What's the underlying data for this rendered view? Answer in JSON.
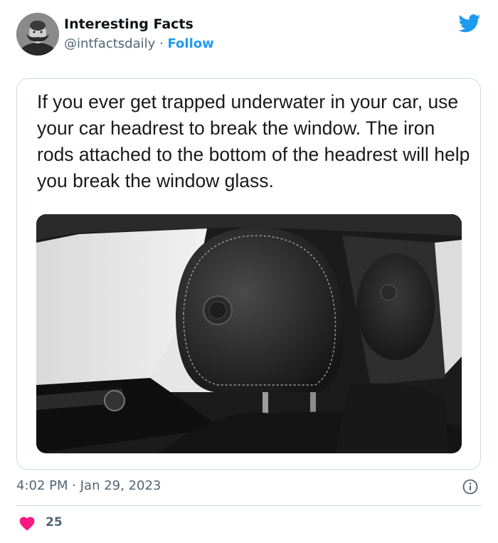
{
  "tweet": {
    "author_name": "Interesting Facts",
    "author_handle": "@intfactsdaily",
    "separator": "·",
    "follow_label": "Follow",
    "image_text": "If you ever get trapped underwater in your car, use your car headrest to break the window. The iron rods attached to the bottom of the headrest will help you break the window glass.",
    "time": "4:02 PM",
    "date": "Jan 29, 2023",
    "like_count": "25"
  },
  "icons": {
    "platform": "twitter-bird-icon",
    "info": "info-icon",
    "like": "heart-icon"
  },
  "colors": {
    "accent": "#1d9bf0",
    "like": "#f91880",
    "muted_text": "#536471",
    "border": "#cfd9de"
  }
}
